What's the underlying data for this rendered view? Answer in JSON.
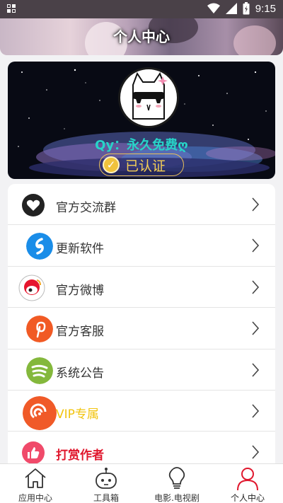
{
  "status_bar": {
    "time": "9:15"
  },
  "header": {
    "title": "个人中心"
  },
  "profile": {
    "username": "Qy：永久免费ღ",
    "verified_label": "已认证",
    "verified_color": "#f5cf56",
    "username_color": "#27d4c8"
  },
  "menu": [
    {
      "label": "官方交流群",
      "icon": "heart-icon",
      "color": "#333333"
    },
    {
      "label": "更新软件",
      "icon": "shazam-icon",
      "color": "#333333"
    },
    {
      "label": "官方微博",
      "icon": "weibo-icon",
      "color": "#333333"
    },
    {
      "label": "官方客服",
      "icon": "pinterest-icon",
      "color": "#333333"
    },
    {
      "label": "系统公告",
      "icon": "spotify-icon",
      "color": "#333333"
    },
    {
      "label": "VIP专属",
      "icon": "vip-icon",
      "color": "#f2c40f"
    },
    {
      "label": "打赏作者",
      "icon": "thumbs-up-icon",
      "color": "#e0172d"
    }
  ],
  "bottom_nav": [
    {
      "label": "应用中心",
      "icon": "home-icon"
    },
    {
      "label": "工具箱",
      "icon": "robot-icon"
    },
    {
      "label": "电影.电视剧",
      "icon": "lightbulb-icon"
    },
    {
      "label": "个人中心",
      "icon": "user-icon",
      "active": true
    }
  ],
  "accent_color": "#e0172d"
}
